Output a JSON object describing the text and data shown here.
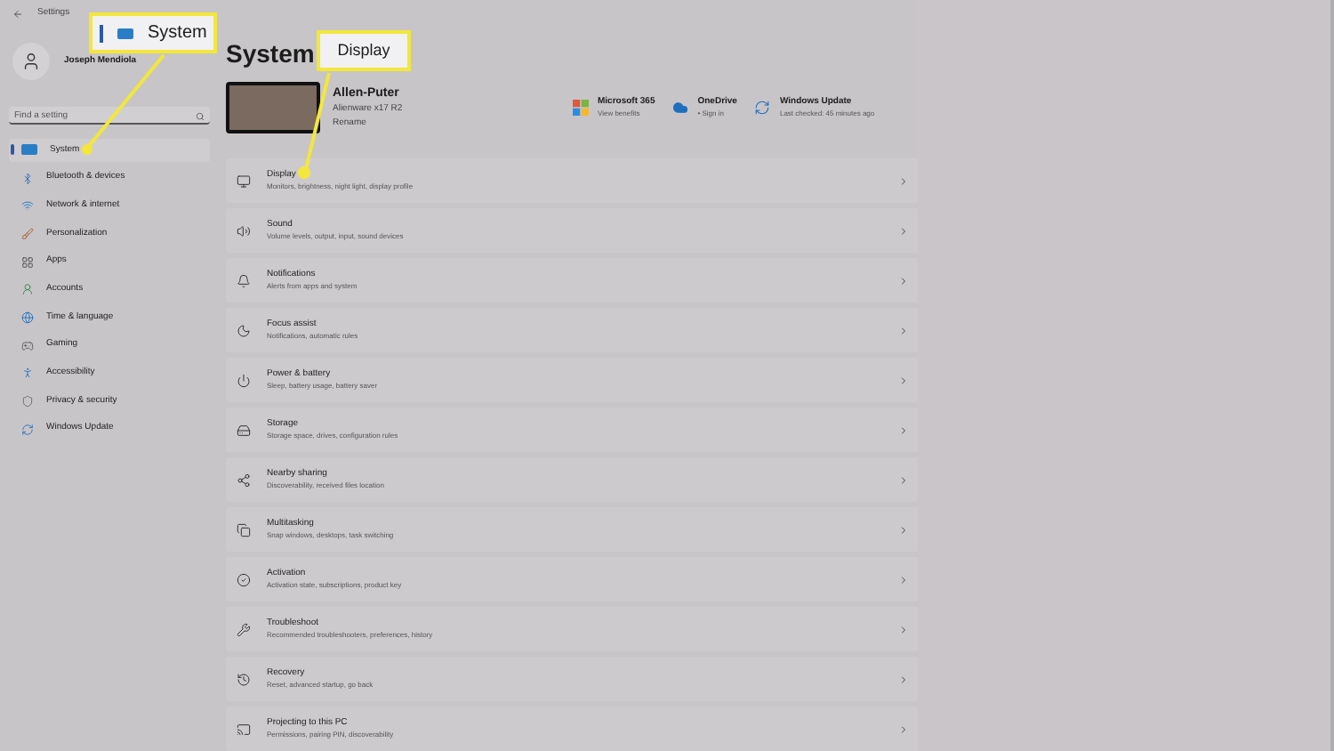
{
  "window": {
    "title": "Settings"
  },
  "user": {
    "name": "Joseph Mendiola"
  },
  "search": {
    "placeholder": "Find a setting"
  },
  "sidebar": {
    "items": [
      {
        "label": "System",
        "selected": true
      },
      {
        "label": "Bluetooth & devices",
        "selected": false
      },
      {
        "label": "Network & internet",
        "selected": false
      },
      {
        "label": "Personalization",
        "selected": false
      },
      {
        "label": "Apps",
        "selected": false
      },
      {
        "label": "Accounts",
        "selected": false
      },
      {
        "label": "Time & language",
        "selected": false
      },
      {
        "label": "Gaming",
        "selected": false
      },
      {
        "label": "Accessibility",
        "selected": false
      },
      {
        "label": "Privacy & security",
        "selected": false
      },
      {
        "label": "Windows Update",
        "selected": false
      }
    ]
  },
  "page_title": "System",
  "device": {
    "name": "Allen-Puter",
    "model": "Alienware x17 R2",
    "rename": "Rename"
  },
  "tiles": [
    {
      "title": "Microsoft 365",
      "subtitle": "View benefits"
    },
    {
      "title": "OneDrive",
      "subtitle": "• Sign in"
    },
    {
      "title": "Windows Update",
      "subtitle": "Last checked: 45 minutes ago"
    }
  ],
  "settings": [
    {
      "title": "Display",
      "subtitle": "Monitors, brightness, night light, display profile"
    },
    {
      "title": "Sound",
      "subtitle": "Volume levels, output, input, sound devices"
    },
    {
      "title": "Notifications",
      "subtitle": "Alerts from apps and system"
    },
    {
      "title": "Focus assist",
      "subtitle": "Notifications, automatic rules"
    },
    {
      "title": "Power & battery",
      "subtitle": "Sleep, battery usage, battery saver"
    },
    {
      "title": "Storage",
      "subtitle": "Storage space, drives, configuration rules"
    },
    {
      "title": "Nearby sharing",
      "subtitle": "Discoverability, received files location"
    },
    {
      "title": "Multitasking",
      "subtitle": "Snap windows, desktops, task switching"
    },
    {
      "title": "Activation",
      "subtitle": "Activation state, subscriptions, product key"
    },
    {
      "title": "Troubleshoot",
      "subtitle": "Recommended troubleshooters, preferences, history"
    },
    {
      "title": "Recovery",
      "subtitle": "Reset, advanced startup, go back"
    },
    {
      "title": "Projecting to this PC",
      "subtitle": "Permissions, pairing PIN, discoverability"
    }
  ],
  "callouts": [
    {
      "label": "System"
    },
    {
      "label": "Display"
    }
  ]
}
